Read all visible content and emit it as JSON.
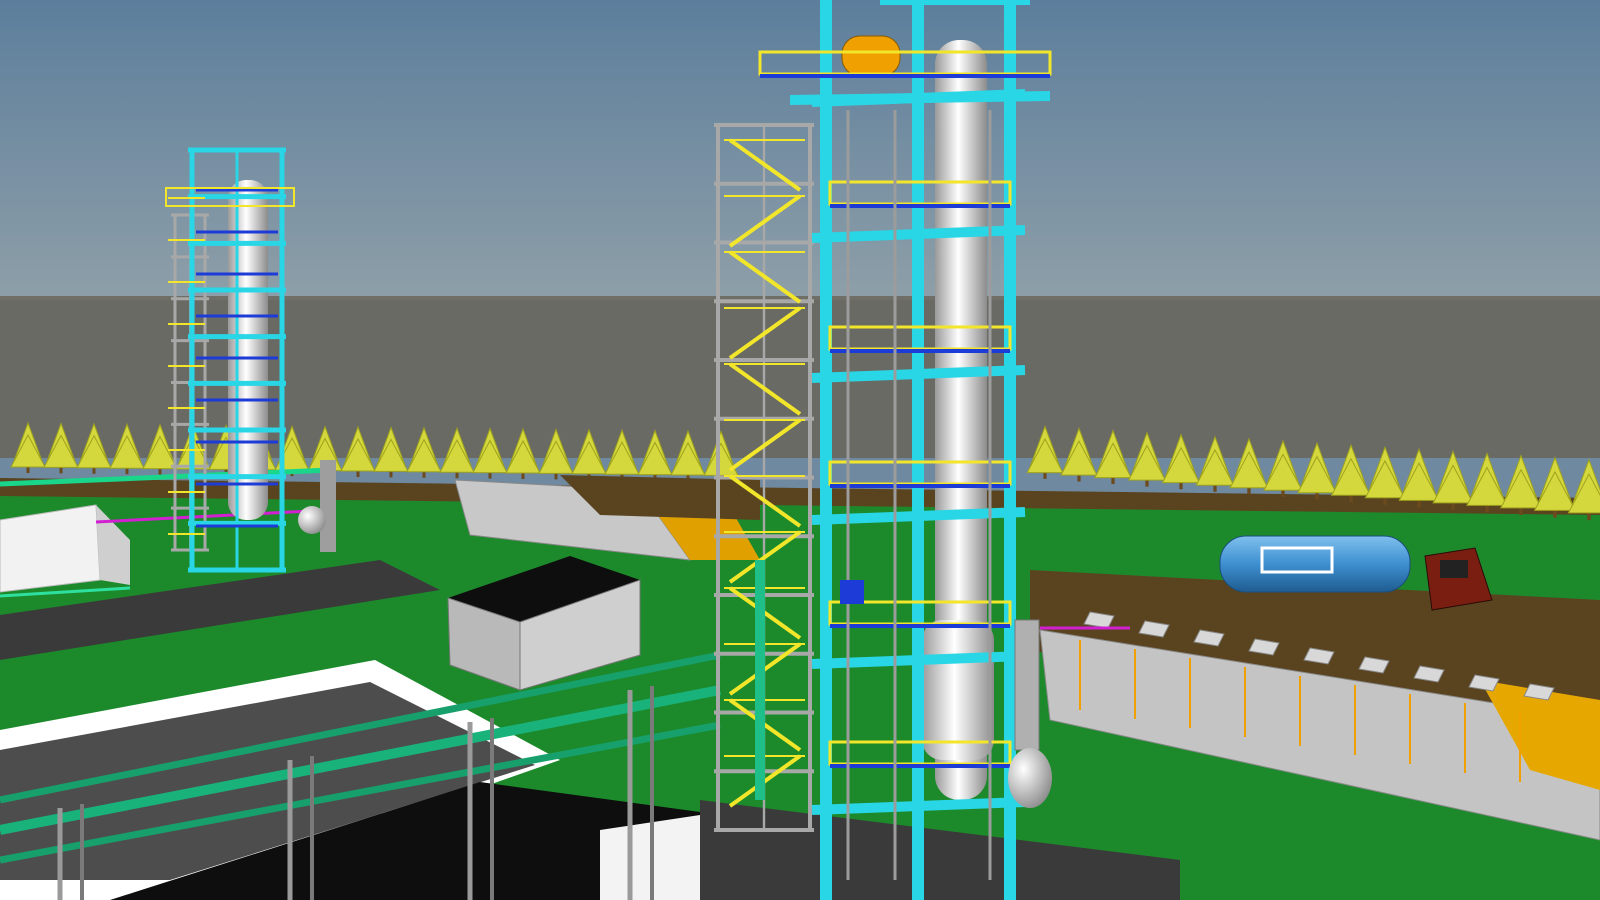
{
  "scene": {
    "kind": "3d-plant-model-render",
    "components": [
      "sky",
      "ground",
      "tree-line",
      "left-distillation-column",
      "main-distillation-column",
      "stair-tower",
      "pipe-racks",
      "treatment-basins",
      "storage-tank",
      "tanker-truck",
      "buildings",
      "lamp-posts"
    ]
  },
  "colors": {
    "sky_top": "#5c7e9c",
    "sky_bottom": "#8e9fa8",
    "horizon": "#6f6f68",
    "ground_far": "#6a6a64",
    "grass": "#1c8a2b",
    "grass_dark": "#127022",
    "road": "#3a3a3a",
    "soil": "#5a4420",
    "tree_leaf": "#d4d83c",
    "tree_trunk": "#6b4a1e",
    "frame_cyan": "#29d6e6",
    "steel_gray": "#a8a8a8",
    "stair_yellow": "#f2e62a",
    "column_white": "#e6e6e6",
    "pipe_green": "#19b27a",
    "pipe_blue": "#1d3bd6",
    "pipe_magenta": "#d21fd2",
    "building_wall": "#d6d6d6",
    "building_roof": "#101010",
    "basin_wall": "#bfbfbf",
    "accent_orange": "#f0a000",
    "tank_blue": "#3e8fd0",
    "truck_red": "#7a1e12"
  }
}
